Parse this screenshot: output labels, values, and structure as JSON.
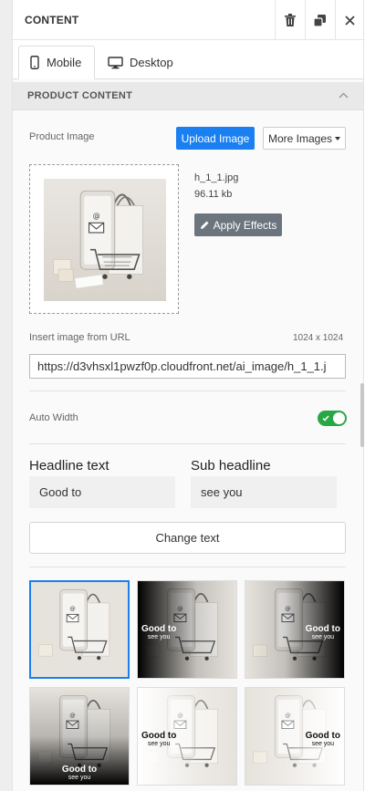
{
  "header": {
    "title": "CONTENT"
  },
  "tabs": [
    {
      "label": "Mobile"
    },
    {
      "label": "Desktop"
    }
  ],
  "section": {
    "title": "PRODUCT CONTENT"
  },
  "product_image": {
    "label": "Product Image",
    "upload_label": "Upload Image",
    "more_label": "More Images",
    "file_name": "h_1_1.jpg",
    "file_size": "96.11 kb",
    "apply_label": "Apply Effects"
  },
  "url": {
    "label": "Insert image from URL",
    "dimensions": "1024 x 1024",
    "value": "https://d3vhsxl1pwzf0p.cloudfront.net/ai_image/h_1_1.j"
  },
  "auto_width": {
    "label": "Auto Width",
    "enabled": true
  },
  "headline": {
    "label": "Headline text",
    "value": "Good to"
  },
  "subheadline": {
    "label": "Sub headline",
    "value": "see you"
  },
  "change_text_label": "Change text",
  "previews": [
    {
      "style": "plain",
      "selected": true
    },
    {
      "style": "dark-left",
      "selected": false,
      "headline": "Good to",
      "sub": "see you"
    },
    {
      "style": "dark-right",
      "selected": false,
      "headline": "Good to",
      "sub": "see you"
    },
    {
      "style": "dark-bottom",
      "selected": false,
      "headline": "Good to",
      "sub": "see you"
    },
    {
      "style": "light-left",
      "selected": false,
      "headline": "Good to",
      "sub": "see you"
    },
    {
      "style": "light-right",
      "selected": false,
      "headline": "Good to",
      "sub": "see you"
    }
  ],
  "colors": {
    "accent": "#1a7ff0",
    "toggle_on": "#28a745",
    "apply_bg": "#6c757d"
  }
}
